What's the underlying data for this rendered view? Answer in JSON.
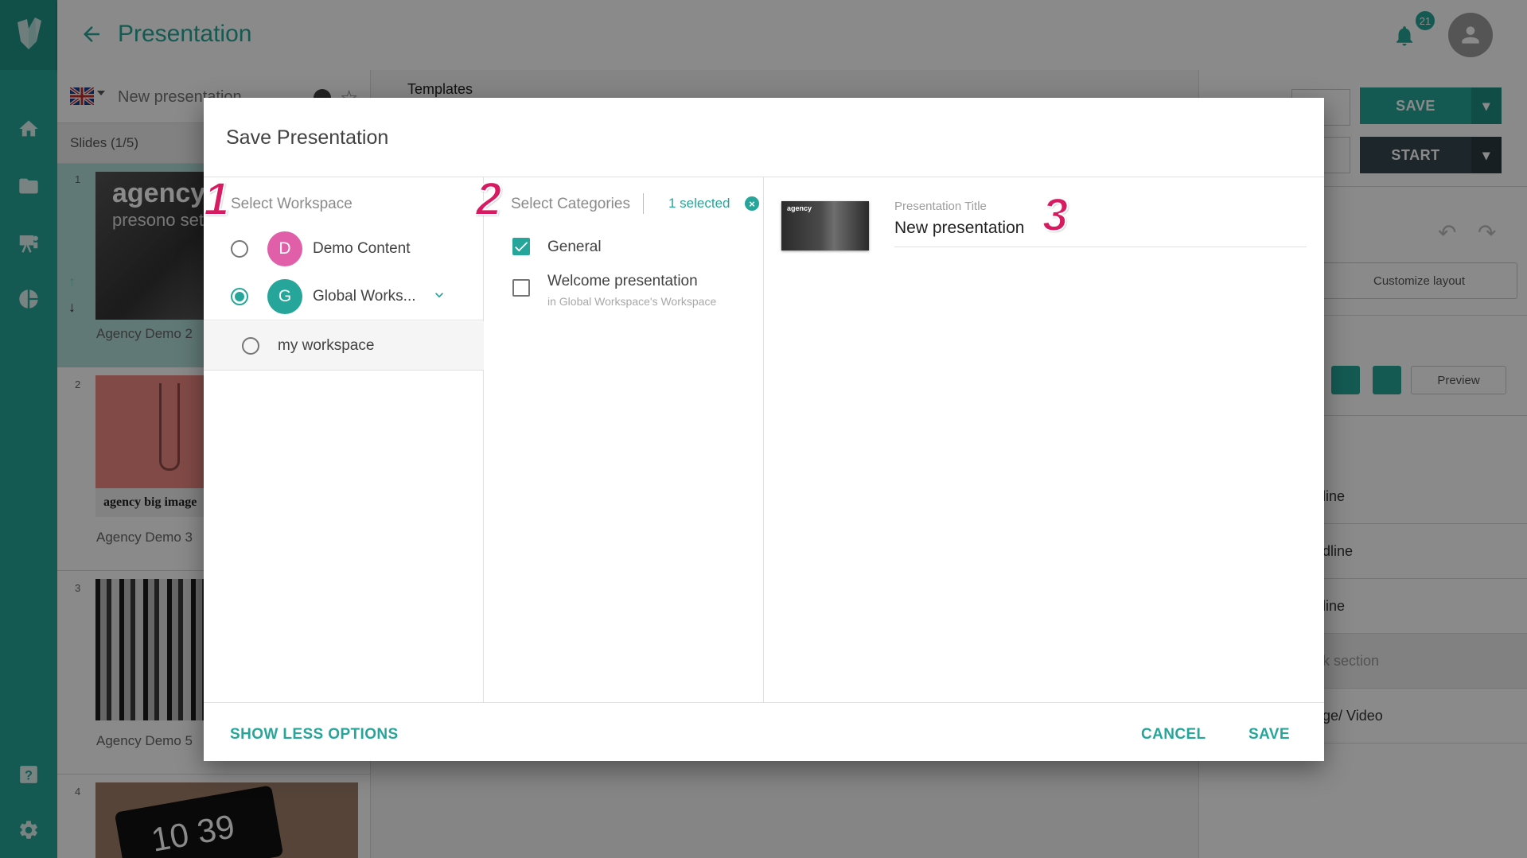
{
  "header": {
    "title": "Presentation",
    "notification_count": "21"
  },
  "slides_panel": {
    "language": "en-GB",
    "presentation_name": "New presentation",
    "slides_count": "Slides (1/5)",
    "slides": [
      {
        "number": "1",
        "label": "Agency Demo 2",
        "thumb_title": "agency",
        "thumb_subtitle": "presono set"
      },
      {
        "number": "2",
        "label": "Agency Demo 3",
        "thumb_title": "agency big image"
      },
      {
        "number": "3",
        "label": "Agency Demo 5"
      },
      {
        "number": "4",
        "label": "",
        "thumb_text": "10 39"
      }
    ]
  },
  "middle": {
    "templates_label": "Templates"
  },
  "right_panel": {
    "save_label": "SAVE",
    "start_label": "START",
    "customize_label": "Customize layout",
    "preview_label": "Preview",
    "items": [
      "line",
      "dline",
      "line",
      "k section",
      "ge/ Video"
    ]
  },
  "dialog": {
    "title": "Save Presentation",
    "workspace": {
      "heading": "Select Workspace",
      "marker": "1",
      "items": [
        {
          "initial": "D",
          "name": "Demo Content",
          "color": "#e05fa8",
          "selected": false
        },
        {
          "initial": "G",
          "name": "Global Works...",
          "color": "#26a69a",
          "selected": true
        },
        {
          "name": "my workspace",
          "selected": false
        }
      ]
    },
    "categories": {
      "heading": "Select Categories",
      "marker": "2",
      "selected_text": "1 selected",
      "items": [
        {
          "name": "General",
          "checked": true
        },
        {
          "name": "Welcome presentation",
          "sub": "in Global Workspace's Workspace",
          "checked": false
        }
      ]
    },
    "title_field": {
      "label": "Presentation Title",
      "value": "New presentation",
      "marker": "3"
    },
    "footer": {
      "show_less": "SHOW LESS OPTIONS",
      "cancel": "CANCEL",
      "save": "SAVE"
    }
  },
  "colors": {
    "accent": "#26a69a",
    "dark": "#37474f",
    "marker": "#d81b60",
    "avatar_d": "#e05fa8"
  }
}
